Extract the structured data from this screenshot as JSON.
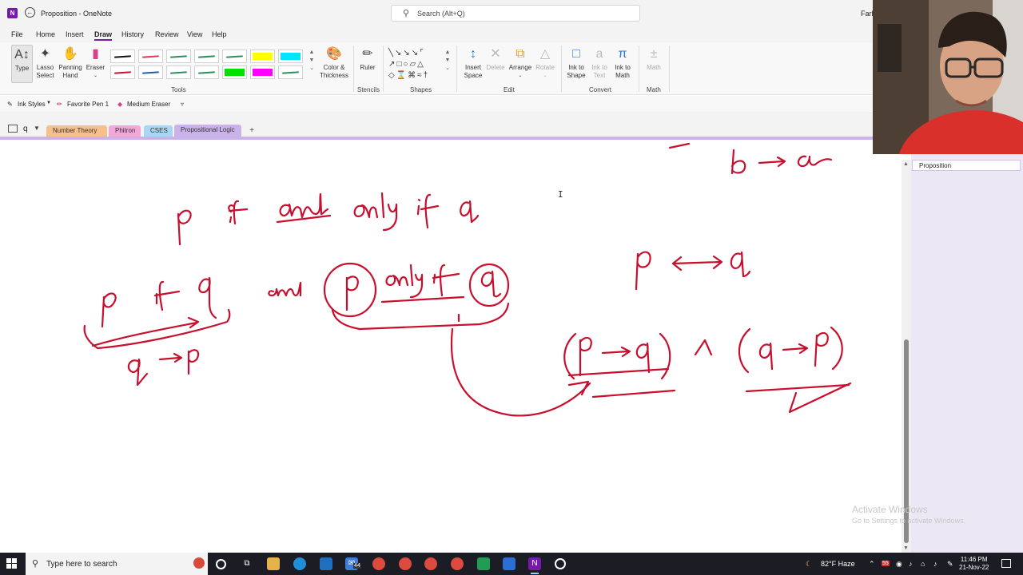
{
  "titlebar": {
    "app_icon_letter": "N",
    "title": "Proposition  -  OneNote",
    "search_placeholder": "Search (Alt+Q)",
    "user_name": "Farh"
  },
  "menu": {
    "items": [
      "File",
      "Home",
      "Insert",
      "Draw",
      "History",
      "Review",
      "View",
      "Help"
    ],
    "active": "Draw"
  },
  "ribbon": {
    "tools": {
      "type_label": "Type",
      "lasso_label": "Lasso\nSelect",
      "panning_label": "Panning\nHand",
      "eraser_label": "Eraser",
      "color_label": "Color &\nThickness",
      "group_label": "Tools",
      "pen_colors_row1": [
        "#111111",
        "#d04050",
        "#2f8f5a",
        "#2f8f5a",
        "#2f8f5a",
        "#ffff00",
        "#00e5ff"
      ],
      "pen_colors_row2": [
        "#c8102e",
        "#1e5fa8",
        "#2f8f5a",
        "#2f8f5a",
        "#00e000",
        "#ff00ff",
        "#2f8f5a"
      ]
    },
    "stencils": {
      "ruler_label": "Ruler",
      "group_label": "Stencils"
    },
    "shapes": {
      "group_label": "Shapes"
    },
    "edit": {
      "insert_space_label": "Insert\nSpace",
      "delete_label": "Delete",
      "arrange_label": "Arrange",
      "rotate_label": "Rotate",
      "group_label": "Edit"
    },
    "convert": {
      "ink_to_shape_label": "Ink to\nShape",
      "ink_to_text_label": "Ink to\nText",
      "ink_to_math_label": "Ink to\nMath",
      "group_label": "Convert"
    },
    "math": {
      "math_label": "Math",
      "group_label": "Math"
    }
  },
  "inkbar": {
    "ink_styles": "Ink Styles",
    "favorite_pen": "Favorite Pen 1",
    "medium_eraser": "Medium Eraser"
  },
  "notebook": {
    "name": "q",
    "sections": [
      {
        "label": "Number Theory",
        "color": "#f7c08a"
      },
      {
        "label": "Phitron",
        "color": "#f3a7d9"
      },
      {
        "label": "CSES",
        "color": "#a9d6f2"
      },
      {
        "label": "Propositional Logic",
        "color": "#c9b3e8"
      }
    ],
    "active_section": "Propositional Logic"
  },
  "pages": {
    "items": [
      "Proposition"
    ]
  },
  "watermark": {
    "line1": "Activate Windows",
    "line2": "Go to Settings to activate Windows."
  },
  "taskbar": {
    "search_text": "Type here to search",
    "mail_badge": "44",
    "weather": "82°F  Haze",
    "antivirus_badge": "55",
    "time": "11:46 PM",
    "date": "21-Nov-22"
  },
  "colors": {
    "ink": "#c8102e",
    "accent": "#7719aa",
    "taskbar": "#1c1c24"
  }
}
